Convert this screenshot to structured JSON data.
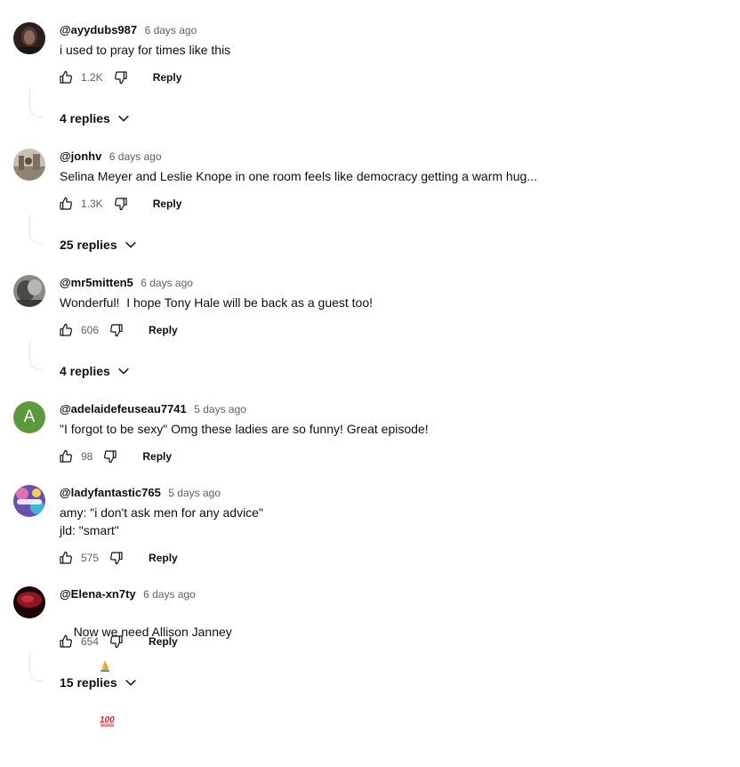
{
  "comments": [
    {
      "author": "@ayydubs987",
      "time": "6 days ago",
      "text": "i used to pray for times like this",
      "likes": "1.2K",
      "reply_label": "Reply",
      "replies_label": "4 replies",
      "avatar_color": "#2a1f1c"
    },
    {
      "author": "@jonhv",
      "time": "6 days ago",
      "text": "Selina Meyer and Leslie Knope in one room feels like democracy getting a warm hug...",
      "likes": "1.3K",
      "reply_label": "Reply",
      "replies_label": "25 replies",
      "avatar_color": "#a69c8a"
    },
    {
      "author": "@mr5mitten5",
      "time": "6 days ago",
      "text": "Wonderful!  I hope Tony Hale will be back as a guest too!",
      "likes": "606",
      "reply_label": "Reply",
      "replies_label": "4 replies",
      "avatar_color": "#6a6a66"
    },
    {
      "author": "@adelaidefeuseau7741",
      "time": "5 days ago",
      "text": "\"I forgot to be sexy\" Omg these ladies are so funny! Great episode!",
      "likes": "98",
      "reply_label": "Reply",
      "avatar_letter": "A",
      "avatar_color": "#5b9a3c"
    },
    {
      "author": "@ladyfantastic765",
      "time": "5 days ago",
      "text": "amy: \"i don't ask men for any advice\"\njld: \"smart\"",
      "likes": "575",
      "reply_label": "Reply",
      "avatar_color": "#7a52b8"
    },
    {
      "author": "@Elena-xn7ty",
      "time": "6 days ago",
      "text": "Now we need Allison Janney",
      "text_emojis": [
        "folded-hands-emoji",
        "hundred-points-emoji"
      ],
      "likes": "654",
      "reply_label": "Reply",
      "replies_label": "15 replies",
      "avatar_color": "#6b0f16"
    }
  ],
  "colors": {
    "text_primary": "#0f0f0f",
    "text_secondary": "#606060",
    "thread_line": "#e5e5e5"
  },
  "icons": {
    "like": "thumbs-up-icon",
    "dislike": "thumbs-down-icon",
    "expand": "chevron-down-icon"
  }
}
